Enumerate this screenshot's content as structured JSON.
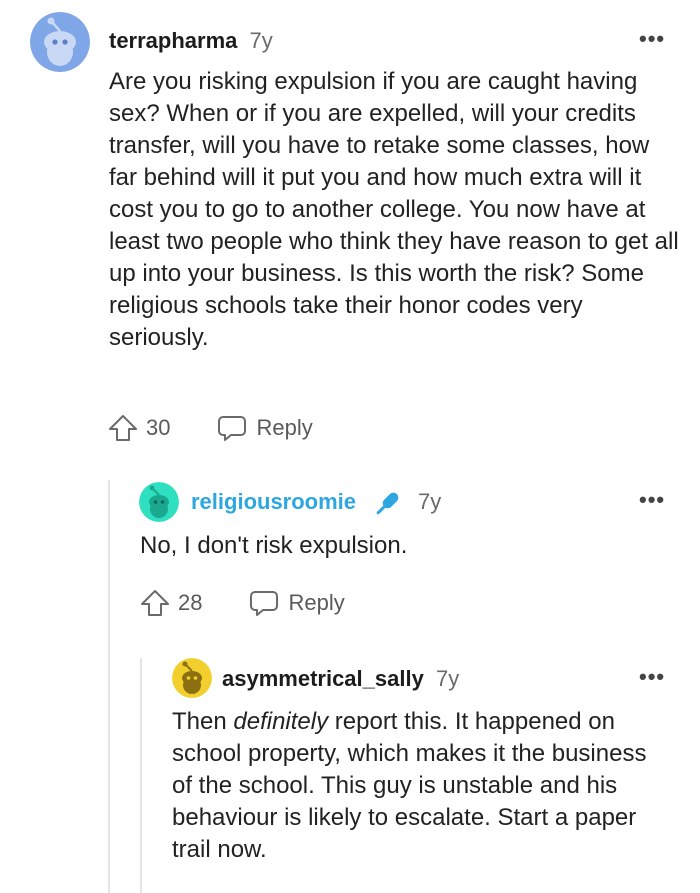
{
  "colors": {
    "accent_blue": "#2ea7e0",
    "text": "#1c1c1c",
    "muted": "#6a6a6a"
  },
  "comments": [
    {
      "username": "terrapharma",
      "age": "7y",
      "avatar_icon": "snoo-avatar-blue",
      "body": "Are you risking expulsion if you are caught having sex? When or if you are expelled, will your credits transfer, will you have to retake some classes, how far behind will it put you and how much extra will it cost you to go to another college. You now have at least two people who think they have reason to get all up into your business. Is this worth the risk? Some religious schools take their honor codes very seriously.",
      "votes": "30",
      "reply_label": "Reply",
      "menu_label": "•••"
    },
    {
      "username": "religiousroomie",
      "is_op": true,
      "op_icon": "microphone-icon",
      "age": "7y",
      "avatar_icon": "snoo-avatar-teal",
      "body": "No, I don't risk expulsion.",
      "votes": "28",
      "reply_label": "Reply",
      "menu_label": "•••"
    },
    {
      "username": "asymmetrical_sally",
      "age": "7y",
      "avatar_icon": "snoo-avatar-yellow",
      "body_before": "Then ",
      "body_italic": "definitely",
      "body_after": " report this. It happened on school property, which makes it the business of the school. This guy is unstable and his behaviour is likely to escalate. Start a paper trail now.",
      "menu_label": "•••"
    }
  ]
}
